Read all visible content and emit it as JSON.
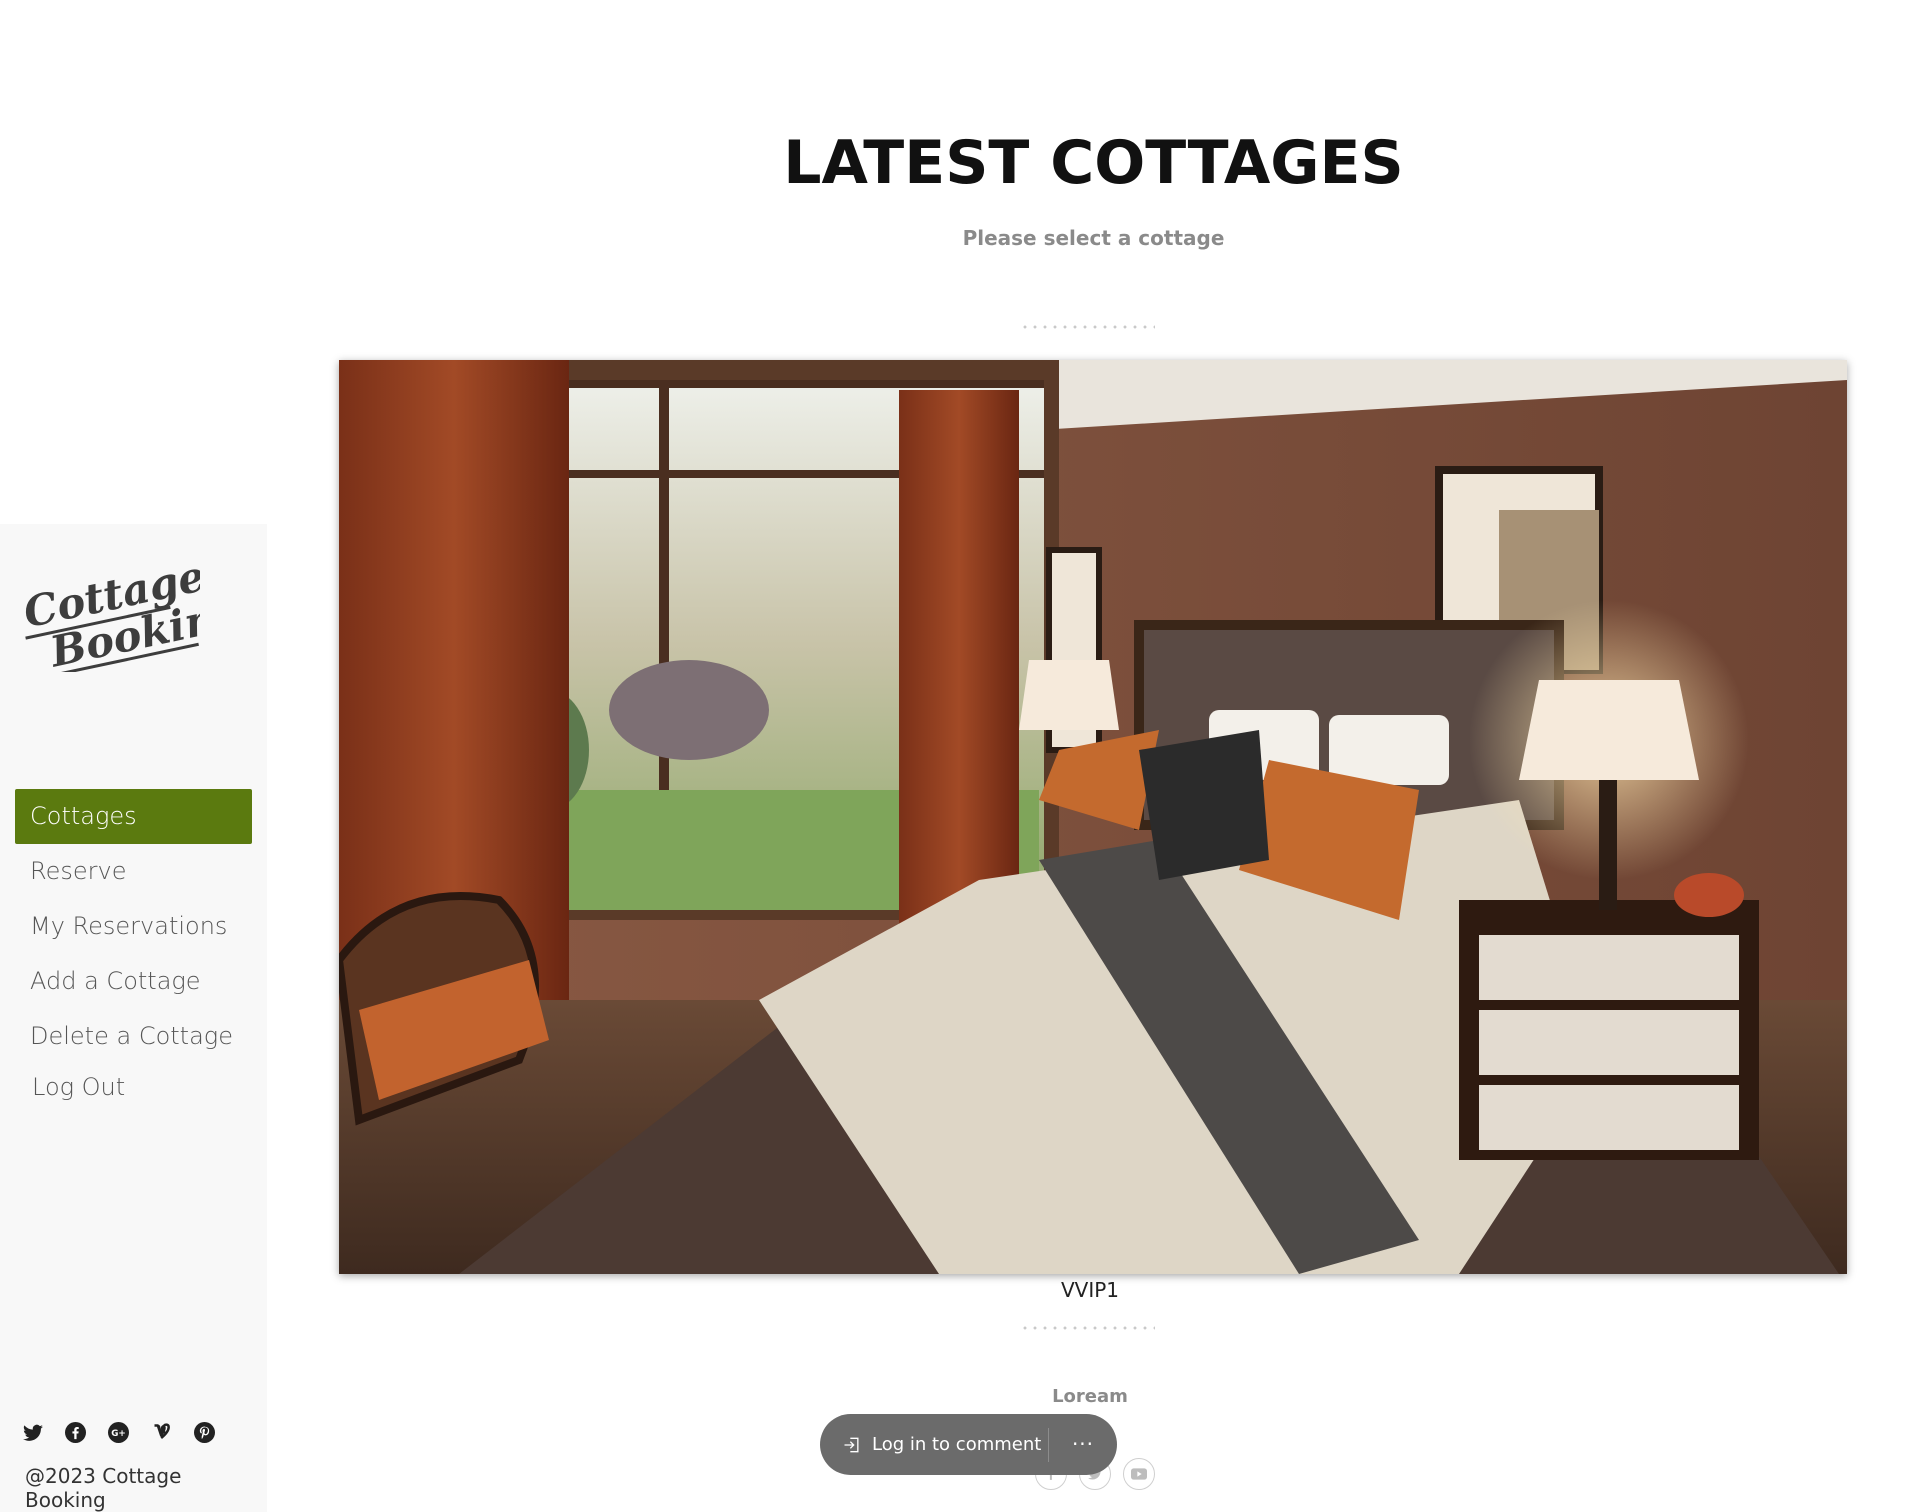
{
  "header": {
    "title": "LATEST COTTAGES",
    "subtitle": "Please select a cottage"
  },
  "sidebar": {
    "logo_text": [
      "Cottage",
      "Booking"
    ],
    "items": [
      {
        "label": "Cottages",
        "active": true
      },
      {
        "label": "Reserve",
        "active": false
      },
      {
        "label": "My Reservations",
        "active": false
      },
      {
        "label": "Add a Cottage",
        "active": false
      },
      {
        "label": "Delete a Cottage",
        "active": false
      },
      {
        "label": "Log Out",
        "active": false
      }
    ],
    "social_icons": [
      "twitter-icon",
      "facebook-icon",
      "google-plus-icon",
      "vine-icon",
      "pinterest-icon"
    ],
    "copyright": "@2023 Cottage Booking"
  },
  "cottage": {
    "name": "VVIP1",
    "description": "Loream",
    "share_icons": [
      "facebook-icon",
      "twitter-icon",
      "youtube-icon"
    ]
  },
  "comment_bar": {
    "login_label": "Log in to comment",
    "more_label": "···"
  },
  "colors": {
    "accent": "#5b7a0f",
    "sidebar_bg": "#f8f8f8",
    "comment_bar_bg": "#6b6b6b"
  }
}
